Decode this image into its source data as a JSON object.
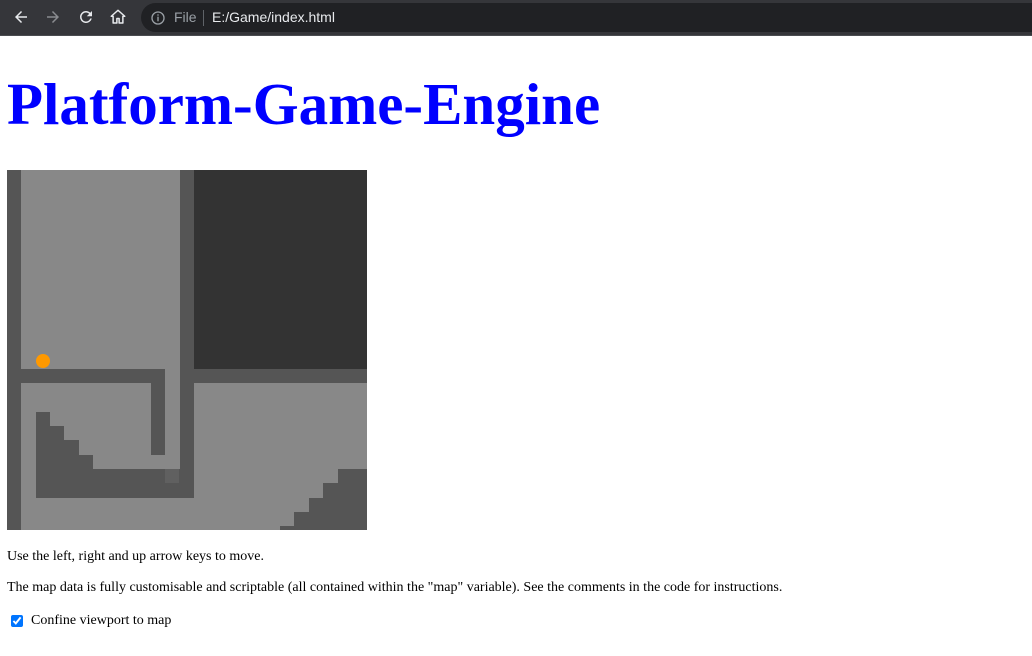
{
  "browser": {
    "file_label": "File",
    "url": "E:/Game/index.html",
    "icons": [
      "back-arrow-icon",
      "forward-arrow-icon",
      "reload-icon",
      "home-icon",
      "info-icon"
    ]
  },
  "page": {
    "title": "Platform-Game-Engine",
    "title_color": "#0000ff",
    "instructions": "Use the left, right and up arrow keys to move.",
    "map_note": "The map data is fully customisable and scriptable (all contained within the \"map\" variable). See the comments in the code for instructions.",
    "confine_label": "Confine viewport to map",
    "confine_checked": true
  },
  "game": {
    "colors": {
      "background": "#888888",
      "wall": "#555555",
      "dark_area": "#333333",
      "player": "#ff9900"
    },
    "player": {
      "shape": "circle"
    }
  }
}
